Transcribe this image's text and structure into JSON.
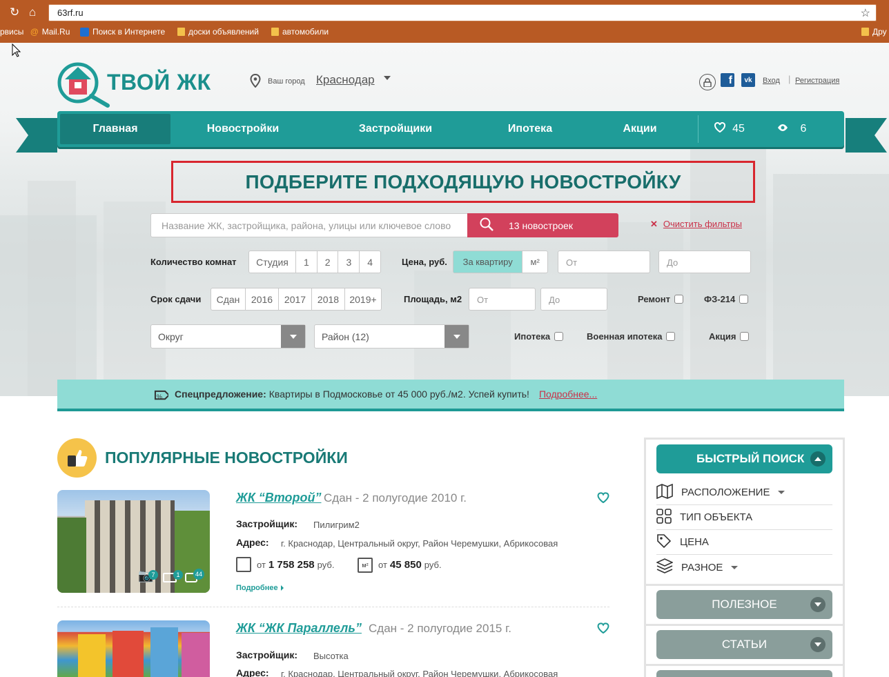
{
  "browser": {
    "url": "63rf.ru",
    "bookmarks": [
      "рвисы",
      "Mail.Ru",
      "Поиск в Интернете",
      "доски объявлений",
      "автомобили",
      "Дру"
    ]
  },
  "header": {
    "logo_text": "ТВОЙ ЖК",
    "city_label": "Ваш город",
    "city": "Краснодар",
    "login": "Вход",
    "register": "Регистрация"
  },
  "nav": {
    "items": [
      "Главная",
      "Новостройки",
      "Застройщики",
      "Ипотека",
      "Акции"
    ],
    "favorites_count": "45",
    "views_count": "6"
  },
  "hero": {
    "title": "ПОДБЕРИТЕ ПОДХОДЯЩУЮ НОВОСТРОЙКУ",
    "search_placeholder": "Название ЖК, застройщика, района, улицы или ключевое слово",
    "search_button": "13 новостроек",
    "clear_filters": "Очистить фильтры"
  },
  "filters": {
    "rooms_label": "Количество комнат",
    "rooms": [
      "Студия",
      "1",
      "2",
      "3",
      "4"
    ],
    "price_label": "Цена, руб.",
    "price_modes": [
      "За квартиру",
      "м²"
    ],
    "from": "От",
    "to": "До",
    "deadline_label": "Срок сдачи",
    "deadlines": [
      "Сдан",
      "2016",
      "2017",
      "2018",
      "2019+"
    ],
    "area_label": "Площадь, м2",
    "renovation": "Ремонт",
    "fz214": "ФЗ-214",
    "district_select": "Округ",
    "area_select": "Район (12)",
    "mortgage": "Ипотека",
    "military_mortgage": "Военная ипотека",
    "promo": "Акция"
  },
  "promo": {
    "label": "Спецпредложение:",
    "text": "Квартиры в Подмосковье от 45 000 руб./м2. Успей купить!",
    "link": "Подробнее..."
  },
  "popular": {
    "title": "ПОПУЛЯРНЫЕ НОВОСТРОЙКИ",
    "developer_label": "Застройщик:",
    "address_label": "Адрес:",
    "from": "от",
    "rub": "руб.",
    "more": "Подробнее",
    "items": [
      {
        "name": "ЖК “Второй”",
        "status": "Сдан - 2 полугодие 2010 г.",
        "developer": "Пилигрим2",
        "address": "г. Краснодар, Центральный округ, Район Черемушки, Абрикосовая",
        "price_total": "1 758 258",
        "price_m2": "45 850",
        "photos": "7",
        "videos": "1",
        "comments": "44"
      },
      {
        "name": "ЖК “ЖК Параллель”",
        "status": "Сдан - 2 полугодие 2015 г.",
        "developer": "Высотка",
        "address": "г. Краснодар, Центральный округ, Район Черемушки, Абрикосовая"
      }
    ]
  },
  "sidebar": {
    "quick_search": "БЫСТРЫЙ ПОИСК",
    "items": [
      "РАСПОЛОЖЕНИЕ",
      "ТИП ОБЪЕКТА",
      "ЦЕНА",
      "РАЗНОЕ"
    ],
    "useful": "ПОЛЕЗНОЕ",
    "articles": "СТАТЬИ"
  },
  "colors": {
    "teal": "#1f9c98",
    "dark_teal": "#187d7a",
    "red_button": "#d2415c",
    "highlight_box": "#d8262e",
    "promo_bg": "#8fdcd5"
  }
}
